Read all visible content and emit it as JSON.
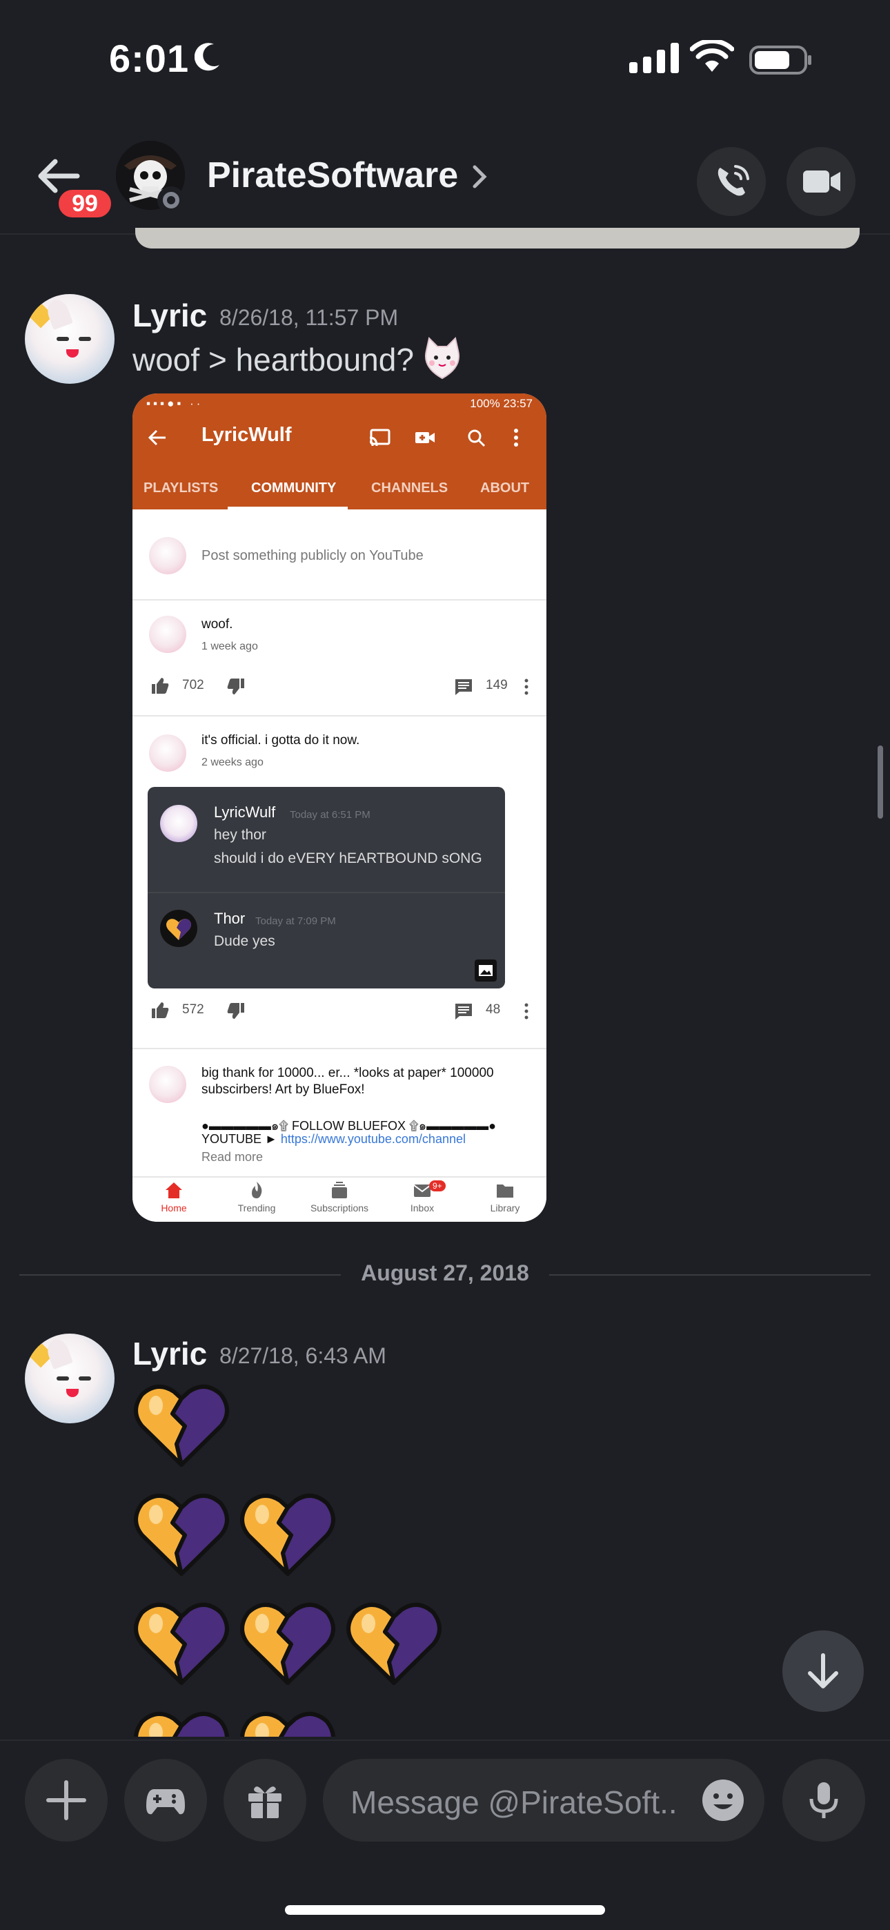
{
  "status_bar": {
    "time": "6:01"
  },
  "header": {
    "unread_badge": "99",
    "channel_name": "PirateSoftware"
  },
  "messages": [
    {
      "author": "Lyric",
      "timestamp": "8/26/18, 11:57 PM",
      "text": "woof > heartbound?"
    },
    {
      "author": "Lyric",
      "timestamp": "8/27/18, 6:43 AM",
      "hearts_rows": [
        1,
        2,
        3,
        2
      ]
    }
  ],
  "embedded_screenshot": {
    "status_bar_right": "100% 23:57",
    "channel_title": "LyricWulf",
    "tabs": [
      "PLAYLISTS",
      "COMMUNITY",
      "CHANNELS",
      "ABOUT"
    ],
    "active_tab": "COMMUNITY",
    "post_prompt": "Post something publicly on YouTube",
    "posts": [
      {
        "text": "woof.",
        "age": "1 week ago",
        "likes": "702",
        "comments": "149"
      },
      {
        "text": "it's official. i gotta do it now.",
        "age": "2 weeks ago",
        "likes": "572",
        "comments": "48"
      }
    ],
    "discord_embed": {
      "msg1_name": "LyricWulf",
      "msg1_time": "Today at 6:51 PM",
      "msg1_line1": "hey thor",
      "msg1_line2": "should i do eVERY hEARTBOUND sONG",
      "msg2_name": "Thor",
      "msg2_time": "Today at 7:09 PM",
      "msg2_line1": "Dude yes"
    },
    "third_post": {
      "line1": "big thank for 10000... er... *looks at paper* 100000",
      "line2": "subscirbers! Art by BlueFox!",
      "line3": "●▬▬▬▬▬๑۩ FOLLOW BLUEFOX ۩๑▬▬▬▬▬●",
      "line4_prefix": "YOUTUBE ► ",
      "line4_link": "https://www.youtube.com/channel",
      "read_more": "Read more"
    },
    "bottom_nav": [
      {
        "label": "Home"
      },
      {
        "label": "Trending"
      },
      {
        "label": "Subscriptions"
      },
      {
        "label": "Inbox"
      },
      {
        "label": "Library"
      }
    ],
    "inbox_badge": "9+"
  },
  "date_divider": "August 27, 2018",
  "composer": {
    "placeholder": "Message @PirateSoft..."
  },
  "colors": {
    "background": "#1e1f24",
    "youtube_header": "#c1501b",
    "badge_red": "#f23f43",
    "heart_gold": "#f6b03a",
    "heart_purple": "#4a2d7d"
  }
}
